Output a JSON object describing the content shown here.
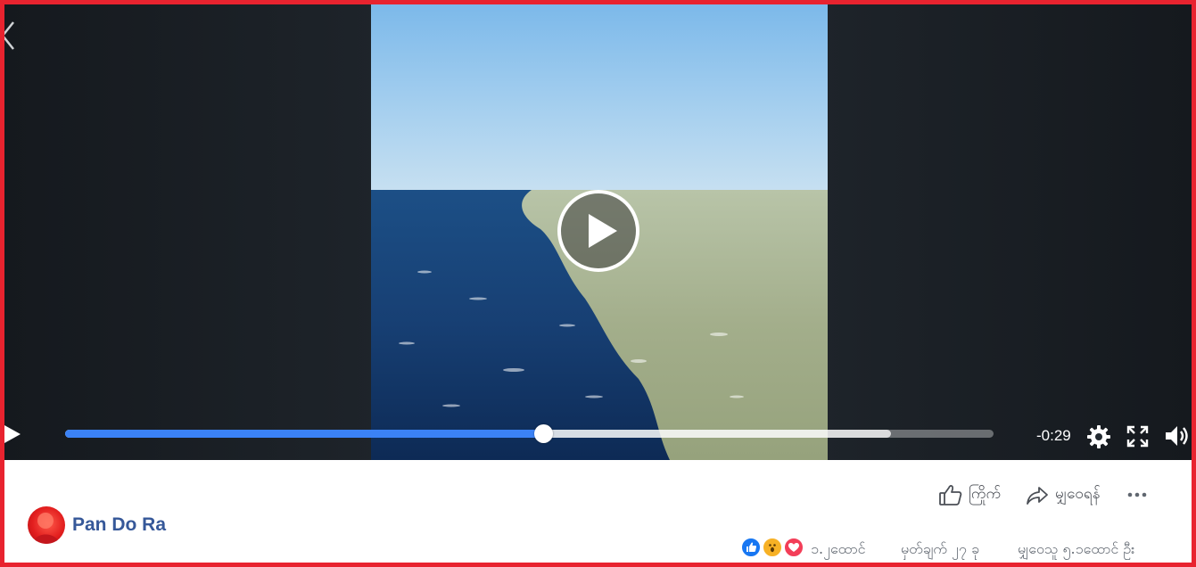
{
  "player": {
    "time_remaining": "-0:29",
    "progress": 0.515,
    "buffered": 0.89
  },
  "post": {
    "author": "Pan Do Ra",
    "actions": {
      "like_label": "ကြိုက်",
      "share_label": "မျှဝေရန်"
    },
    "stats": {
      "reactions_count": "၁.၂ထောင်",
      "comments": "မှတ်ချက် ၂၇ ခု",
      "shares": "မျှဝေသူ ၅.၁ထောင် ဦး"
    }
  },
  "colors": {
    "frame_border": "#e8232f",
    "progress": "#3b82f6",
    "author_link": "#365899",
    "like_reaction": "#1877f2",
    "love_reaction": "#f33e58",
    "wow_reaction": "#f7b125"
  },
  "icons": [
    "back-chevron-icon",
    "play-icon",
    "settings-gear-icon",
    "fullscreen-icon",
    "volume-icon",
    "thumbs-up-icon",
    "share-arrow-icon",
    "more-dots-icon",
    "like-reaction-icon",
    "wow-reaction-icon",
    "love-reaction-icon"
  ]
}
